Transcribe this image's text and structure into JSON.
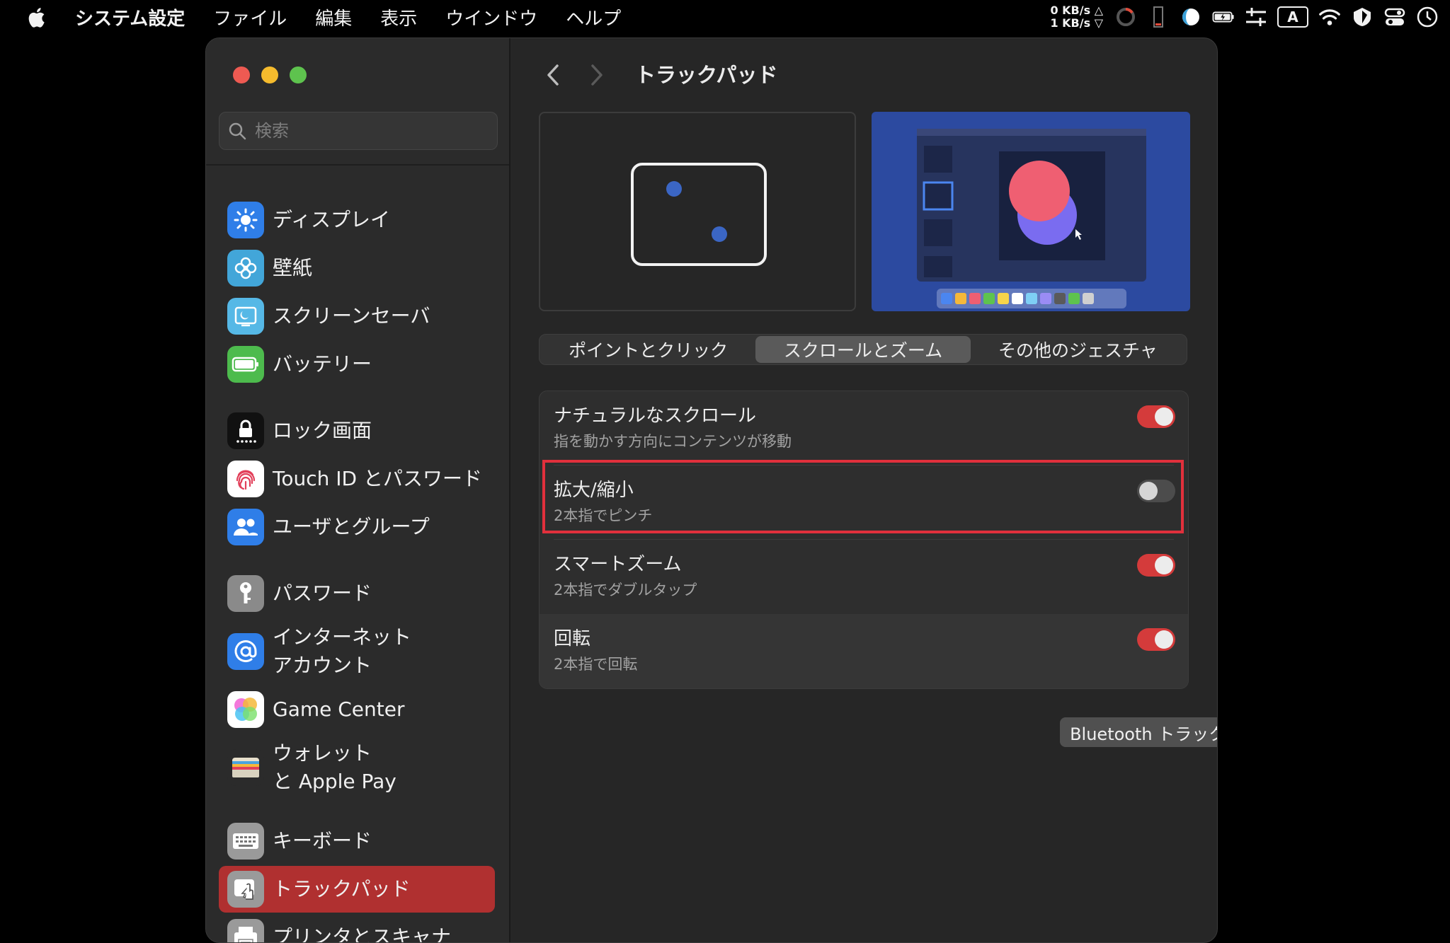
{
  "menubar": {
    "app_name": "システム設定",
    "items": [
      "ファイル",
      "編集",
      "表示",
      "ウインドウ",
      "ヘルプ"
    ],
    "net_up": "0 KB/s △",
    "net_down": "1 KB/s ▽",
    "input_source": "A"
  },
  "window": {
    "search_placeholder": "検索",
    "title": "トラックパッド"
  },
  "sidebar": {
    "items": [
      {
        "label": "ディスプレイ",
        "icon": "display-icon",
        "color": "#2f7ee8"
      },
      {
        "label": "壁紙",
        "icon": "wallpaper-icon",
        "color": "#42a6d9"
      },
      {
        "label": "スクリーンセーバ",
        "icon": "screensaver-icon",
        "color": "#56b8e6"
      },
      {
        "label": "バッテリー",
        "icon": "battery-icon",
        "color": "#4dbb4d"
      },
      {
        "label": "ロック画面",
        "icon": "lock-icon",
        "color": "#111111"
      },
      {
        "label": "Touch ID とパスワード",
        "icon": "fingerprint-icon",
        "color": "#ffffff"
      },
      {
        "label": "ユーザとグループ",
        "icon": "users-icon",
        "color": "#2f7ee8"
      },
      {
        "label": "パスワード",
        "icon": "key-icon",
        "color": "#8a8a8a"
      },
      {
        "label": "インターネット",
        "label2": "アカウント",
        "icon": "at-icon",
        "color": "#2f7ee8"
      },
      {
        "label": "Game Center",
        "icon": "game-center-icon",
        "color": "#ffffff"
      },
      {
        "label": "ウォレット",
        "label2": "と Apple Pay",
        "icon": "wallet-icon",
        "color": "#2b2b2b"
      },
      {
        "label": "キーボード",
        "icon": "keyboard-icon",
        "color": "#9a9a9a"
      },
      {
        "label": "トラックパッド",
        "icon": "trackpad-icon",
        "color": "#9a9a9a",
        "active": true
      },
      {
        "label": "プリンタとスキャナ",
        "icon": "printer-icon",
        "color": "#9a9a9a"
      }
    ]
  },
  "tabs": [
    "ポイントとクリック",
    "スクロールとズーム",
    "その他のジェスチャ"
  ],
  "selected_tab": "スクロールとズーム",
  "settings": [
    {
      "title": "ナチュラルなスクロール",
      "subtitle": "指を動かす方向にコンテンツが移動",
      "enabled": true
    },
    {
      "title": "拡大/縮小",
      "subtitle": "2本指でピンチ",
      "enabled": false
    },
    {
      "title": "スマートズーム",
      "subtitle": "2本指でダブルタップ",
      "enabled": true
    },
    {
      "title": "回転",
      "subtitle": "2本指で回転",
      "enabled": true
    }
  ],
  "buttons": {
    "bluetooth": "Bluetooth トラックパッドを設定...",
    "help": "?"
  },
  "colors": {
    "accent": "#d43b3b",
    "highlight": "#e1303c",
    "sidebar_selected": "#b03030"
  }
}
